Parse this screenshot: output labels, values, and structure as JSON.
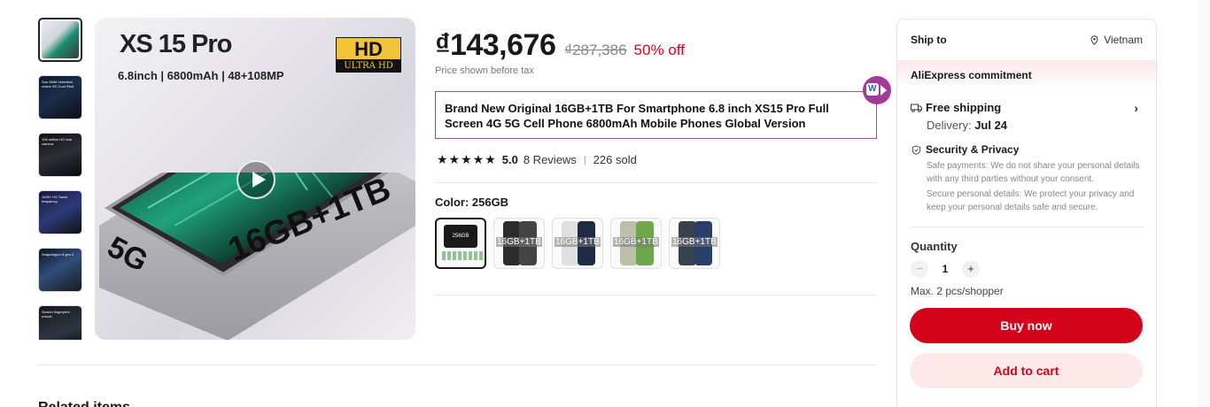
{
  "gallery": {
    "thumb_captions": [
      "",
      "Sun 3MM Unlimited macro 5G Cool Shot",
      "108 million HD rear camera",
      "1000+ HZ Touch frequency",
      "Snapdragon 8 gen 2",
      "Screen fingerprint unlock"
    ],
    "main": {
      "title": "XS 15 Pro",
      "specs": "6.8inch  |  6800mAh  |  48+108MP",
      "hd_top": "HD",
      "hd_bottom": "ULTRA HD",
      "big_text": "16GB+1TB",
      "network": "5G"
    }
  },
  "price": {
    "current": "₫143,676",
    "original": "₫287,386",
    "discount": "50% off",
    "note": "Price shown before tax"
  },
  "product": {
    "title": "Brand New Original 16GB+1TB For Smartphone 6.8 inch XS15 Pro Full Screen 4G 5G Cell Phone 6800mAh Mobile Phones Global Version",
    "extension_label": "W"
  },
  "rating": {
    "stars": "★★★★★",
    "score": "5.0",
    "reviews": "8 Reviews",
    "separator": "|",
    "sold": "226 sold"
  },
  "color": {
    "label": "Color: 256GB",
    "options": [
      {
        "label": "256GB",
        "tint": "#1a1a1a"
      },
      {
        "label": "16GB+1TB",
        "tint": "#2c2c2e"
      },
      {
        "label": "16GB+1TB",
        "tint": "#dfe0e2"
      },
      {
        "label": "16GB+1TB",
        "tint": "#b9c1a8"
      },
      {
        "label": "16GB+1TB",
        "tint": "#39414f"
      }
    ]
  },
  "bottom_hint": "Related items",
  "panel": {
    "ship_to": "Ship to",
    "country": "Vietnam",
    "commitment": "AliExpress commitment",
    "free_shipping": "Free shipping",
    "chevron": "›",
    "delivery_prefix": "Delivery: ",
    "delivery_date": "Jul 24",
    "security_title": "Security & Privacy",
    "security_text1": "Safe payments: We do not share your personal details with any third parties without your consent.",
    "security_text2": "Secure personal details: We protect your privacy and keep your personal details safe and secure.",
    "quantity_label": "Quantity",
    "minus": "−",
    "qty_value": "1",
    "plus": "+",
    "max_note": "Max. 2 pcs/shopper",
    "buy_now": "Buy now",
    "add_to_cart": "Add to cart"
  },
  "colors": {
    "accent_red": "#d3031c",
    "discount_red": "#e10021",
    "title_border": "#9b4f9b"
  }
}
